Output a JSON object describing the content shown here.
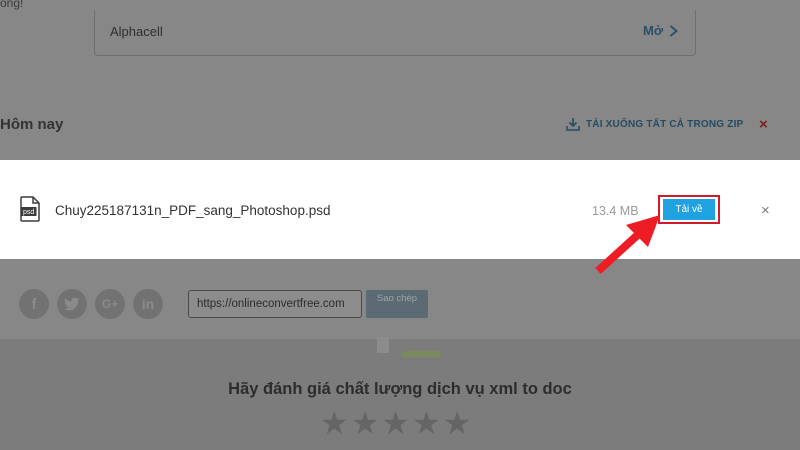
{
  "page": {
    "top_note": "ống!"
  },
  "app_card": {
    "name": "Alphacell",
    "open_label": "Mở"
  },
  "downloads": {
    "section_title": "Hôm nay",
    "zip_label": "TẢI XUỐNG TẤT CẢ TRONG ZIP",
    "dismiss_all": "×",
    "file": {
      "icon_text": "psd",
      "name": "Chuy225187131n_PDF_sang_Photoshop.psd",
      "size": "13.4 MB",
      "download_label": "Tải về",
      "close": "×"
    }
  },
  "share": {
    "icons": [
      "facebook-icon",
      "twitter-icon",
      "google-plus-icon",
      "linkedin-icon"
    ],
    "facebook": "f",
    "google": "G+",
    "linkedin": "in",
    "url": "https://onlineconvertfree.com",
    "copy_label": "Sao chép"
  },
  "rating": {
    "title": "Hãy đánh giá chất lượng dịch vụ xml to doc",
    "star_count": 5
  },
  "colors": {
    "download_button": "#1fa2e0",
    "highlight_border": "#d11a2a",
    "annotation_arrow": "#ee1c25"
  }
}
